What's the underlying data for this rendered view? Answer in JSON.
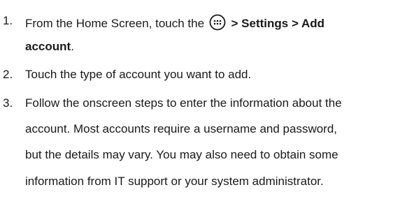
{
  "steps": [
    {
      "number": "1.",
      "line1_pre": "From the Home Screen, touch the",
      "icon": "apps-launcher-icon",
      "line1_path": "> Settings > Add",
      "line2_path": "account",
      "line2_end": "."
    },
    {
      "number": "2.",
      "text": "Touch the type of account you want to add."
    },
    {
      "number": "3.",
      "lines": [
        "Follow the onscreen steps to enter the information about the",
        "account. Most accounts require a username and password,",
        "but the details may vary. You may also need to obtain some",
        "information from IT support or your system administrator."
      ]
    }
  ]
}
